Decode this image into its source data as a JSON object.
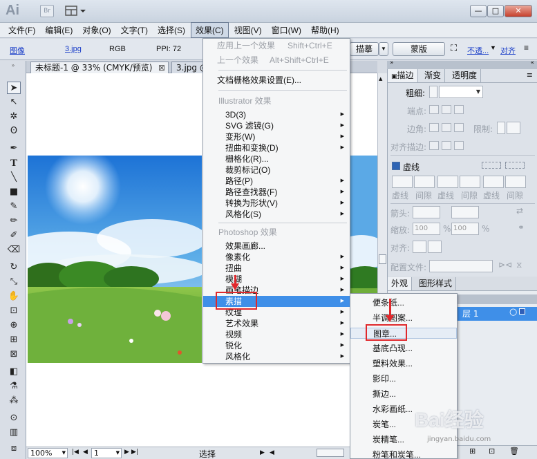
{
  "title_bar": {
    "logo": "Ai",
    "bridge": "Br",
    "win_min": "—",
    "win_max": "□",
    "win_close": "✕"
  },
  "menubar": [
    "文件(F)",
    "编辑(E)",
    "对象(O)",
    "文字(T)",
    "选择(S)",
    "效果(C)",
    "视图(V)",
    "窗口(W)",
    "帮助(H)"
  ],
  "control_bar": {
    "image_label": "图像",
    "filename": "3.jpg",
    "color_mode": "RGB",
    "ppi": "PPI: 72",
    "trace_btn": "描摹",
    "mask_btn": "蒙版",
    "opacity_link": "不透...",
    "align_link": "对齐"
  },
  "doc_tabs": [
    {
      "label": "未标题-1 @ 33% (CMYK/预览)",
      "close": "⊠"
    },
    {
      "label": "3.jpg @"
    }
  ],
  "effects_menu": {
    "apply_last": "应用上一个效果",
    "apply_last_sc": "Shift+Ctrl+E",
    "last_effect": "上一个效果",
    "last_effect_sc": "Alt+Shift+Ctrl+E",
    "raster_settings": "文档栅格效果设置(E)...",
    "illustrator_header": "Illustrator 效果",
    "illustrator_items": [
      "3D(3)",
      "SVG 滤镜(G)",
      "变形(W)",
      "扭曲和变换(D)",
      "栅格化(R)...",
      "裁剪标记(O)",
      "路径(P)",
      "路径查找器(F)",
      "转换为形状(V)",
      "风格化(S)"
    ],
    "photoshop_header": "Photoshop 效果",
    "photoshop_items": [
      "效果画廊...",
      "像素化",
      "扭曲",
      "模糊",
      "画笔描边",
      "素描",
      "纹理",
      "艺术效果",
      "视频",
      "锐化",
      "风格化"
    ]
  },
  "sketch_submenu": [
    "便条纸...",
    "半调图案...",
    "图章...",
    "基底凸现...",
    "塑料效果...",
    "影印...",
    "撕边...",
    "水彩画纸...",
    "炭笔...",
    "炭精笔...",
    "粉笔和炭笔..."
  ],
  "stroke_panel": {
    "tabs": [
      "描边",
      "渐变",
      "透明度"
    ],
    "weight": "粗细:",
    "cap": "端点:",
    "corner": "边角:",
    "limit": "限制:",
    "align_stroke": "对齐描边:",
    "dashed": "虚线",
    "dash_labels": [
      "虚线",
      "间隙",
      "虚线",
      "间隙",
      "虚线",
      "间隙"
    ],
    "arrowheads": "箭头:",
    "scale": "缩放:",
    "scale_val1": "100",
    "scale_val2": "100",
    "pct": "%",
    "align": "对齐:",
    "profile": "配置文件:"
  },
  "appearance_panel": {
    "tabs": [
      "外观",
      "图形样式"
    ],
    "layer": "层 1"
  },
  "status_bar": {
    "zoom": "100%",
    "page": "1",
    "tool": "选择"
  },
  "watermark": {
    "text": "Bai经验",
    "url": "jingyan.baidu.com"
  },
  "colors": {
    "highlight": "#3f8fe8",
    "annotation": "#e0282c"
  }
}
